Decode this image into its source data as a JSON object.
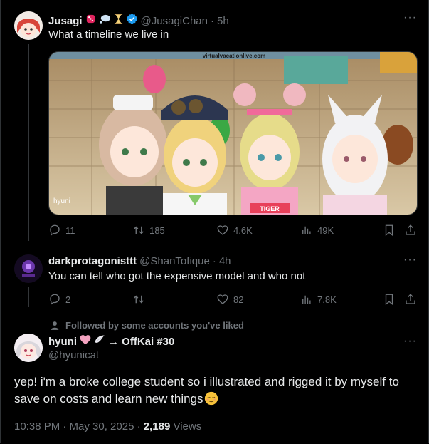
{
  "tweet1": {
    "display_name": "Jusagi",
    "handle": "@JusagiChan",
    "time": "5h",
    "text": "What a timeline we live in",
    "media": {
      "watermark_url": "virtualvacationlive.com",
      "corner_mark": "hyuni",
      "sign_text": "TIGER"
    },
    "stats": {
      "replies": "11",
      "retweets": "185",
      "likes": "4.6K",
      "views": "49K"
    }
  },
  "tweet2": {
    "display_name": "darkprotagonisttt",
    "handle": "@ShanTofique",
    "time": "4h",
    "text": "You can tell who got the expensive model and who not",
    "stats": {
      "replies": "2",
      "retweets": "",
      "likes": "82",
      "views": "7.8K"
    }
  },
  "main_tweet": {
    "social_context": "Followed by some accounts you've liked",
    "display_name": "hyuni",
    "name_suffix": "→ OffKai #30",
    "handle": "@hyunicat",
    "text": "yep! i'm a broke college student so i illustrated and rigged it by myself to save on costs and learn new things",
    "timestamp": "10:38 PM · May 30, 2025 · ",
    "view_count": "2,189",
    "views_label": "Views"
  },
  "separator": "·",
  "more_glyph": "···",
  "icons": [
    "reply-icon",
    "retweet-icon",
    "like-icon",
    "views-icon",
    "bookmark-icon",
    "share-icon",
    "verified-badge-icon",
    "person-icon",
    "heart-emoji-icon",
    "wings-emoji-icon",
    "relieved-emoji-icon"
  ],
  "colors": {
    "background": "#000000",
    "text": "#e7e9ea",
    "muted": "#71767b",
    "verified": "#1d9bf0",
    "border": "#2f3336"
  }
}
